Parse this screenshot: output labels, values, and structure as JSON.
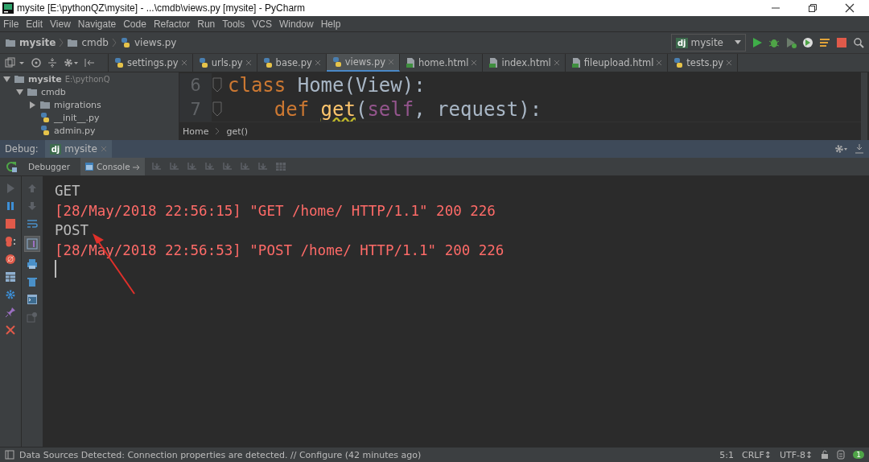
{
  "window": {
    "title": "mysite [E:\\pythonQZ\\mysite] - ...\\cmdb\\views.py [mysite] - PyCharm"
  },
  "menu": [
    "File",
    "Edit",
    "View",
    "Navigate",
    "Code",
    "Refactor",
    "Run",
    "Tools",
    "VCS",
    "Window",
    "Help"
  ],
  "nav_path": [
    {
      "label": "mysite",
      "kind": "project"
    },
    {
      "label": "cmdb",
      "kind": "folder"
    },
    {
      "label": "views.py",
      "kind": "python"
    }
  ],
  "run_config": {
    "badge": "dj",
    "label": "mysite"
  },
  "tabs": [
    {
      "label": "settings.py",
      "kind": "python",
      "selected": false
    },
    {
      "label": "urls.py",
      "kind": "python",
      "selected": false
    },
    {
      "label": "base.py",
      "kind": "python",
      "selected": false
    },
    {
      "label": "views.py",
      "kind": "python",
      "selected": true
    },
    {
      "label": "home.html",
      "kind": "html",
      "selected": false
    },
    {
      "label": "index.html",
      "kind": "html",
      "selected": false
    },
    {
      "label": "fileupload.html",
      "kind": "html",
      "selected": false
    },
    {
      "label": "tests.py",
      "kind": "python",
      "selected": false
    }
  ],
  "project_tree": [
    {
      "label": "mysite",
      "note": "E:\\pythonQ",
      "kind": "project",
      "expanded": true,
      "children": [
        {
          "label": "cmdb",
          "kind": "folder",
          "expanded": true,
          "children": [
            {
              "label": "migrations",
              "kind": "folder",
              "expanded": false
            },
            {
              "label": "__init__.py",
              "kind": "python"
            },
            {
              "label": "admin.py",
              "kind": "python"
            }
          ]
        }
      ]
    }
  ],
  "code_lines": [
    {
      "number": "6",
      "tokens": [
        {
          "text": "class",
          "kind": "keyword"
        },
        {
          "text": " Home(View):",
          "kind": "plain"
        }
      ]
    },
    {
      "number": "7",
      "tokens": [
        {
          "text": "    def ",
          "kind": "keyword"
        },
        {
          "text": "get",
          "kind": "function"
        },
        {
          "text": "(",
          "kind": "plain"
        },
        {
          "text": "self",
          "kind": "self"
        },
        {
          "text": ", request):",
          "kind": "plain"
        }
      ]
    }
  ],
  "breadcrumb": [
    "Home",
    "get()"
  ],
  "debug": {
    "label": "Debug:",
    "badge": "dj",
    "session": "mysite"
  },
  "debug_tabs": [
    {
      "label": "Debugger",
      "selected": false
    },
    {
      "label": "Console",
      "selected": true
    }
  ],
  "console_lines": [
    {
      "text": "GET",
      "kind": "stdout"
    },
    {
      "text": "[28/May/2018 22:56:15] \"GET /home/ HTTP/1.1\" 200 226",
      "kind": "stderr"
    },
    {
      "text": "POST",
      "kind": "stdout"
    },
    {
      "text": "[28/May/2018 22:56:53] \"POST /home/ HTTP/1.1\" 200 226",
      "kind": "stderr"
    }
  ],
  "status_bar": {
    "message": "Data Sources Detected: Connection properties are detected. // Configure (42 minutes ago)",
    "position": "5:1",
    "line_separator": "CRLF↕",
    "encoding": "UTF-8↕",
    "notifications": "1"
  }
}
